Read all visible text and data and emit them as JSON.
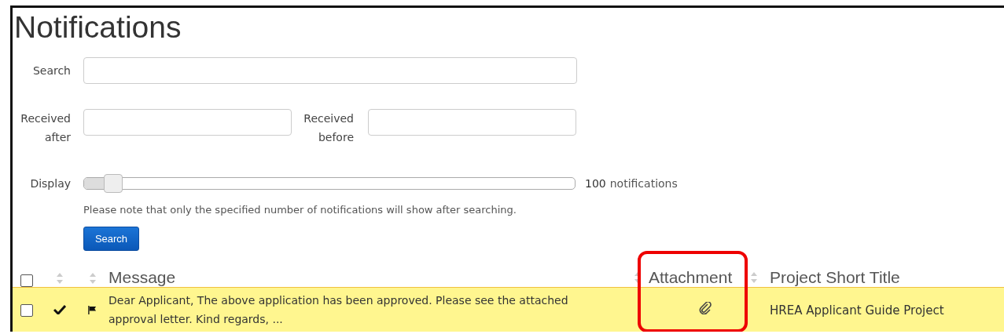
{
  "title": "Notifications",
  "filters": {
    "search": {
      "label": "Search"
    },
    "received_after": {
      "label": "Received\nafter"
    },
    "received_before": {
      "label": "Received\nbefore"
    }
  },
  "display": {
    "label": "Display",
    "level": 0.04,
    "count": "100",
    "unit": "notifications",
    "note": "Please note that only the specified number of notifications will show after searching."
  },
  "search_button": "Search",
  "table": {
    "select_all_checked": false,
    "columns": [
      {
        "label": "Message",
        "sortable": true,
        "highlighted": false
      },
      {
        "label": "Attachment",
        "sortable": true,
        "highlighted": true
      },
      {
        "label": "Project Short Title",
        "sortable": false,
        "highlighted": false
      }
    ],
    "rows": [
      {
        "checked": false,
        "read": true,
        "flagged": true,
        "message": "Dear Applicant, The above application has been approved. Please see the attached approval letter. Kind regards, ...",
        "attachment": true,
        "project": "HREA Applicant Guide Project",
        "highlighted": true
      }
    ]
  }
}
